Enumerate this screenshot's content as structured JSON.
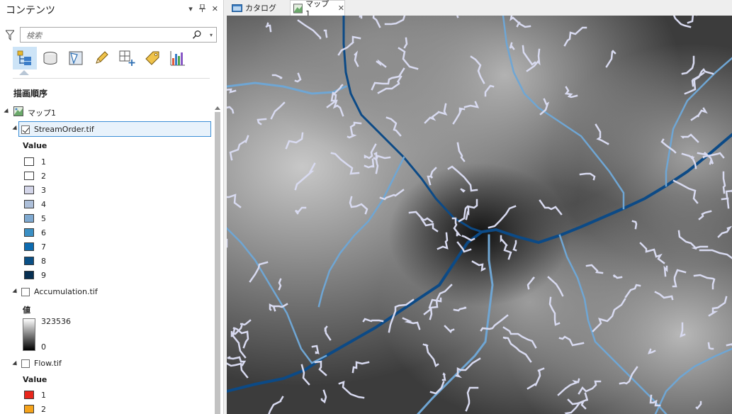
{
  "pane": {
    "title": "コンテンツ",
    "header_buttons": [
      "▾",
      "ᵖ",
      "✕"
    ],
    "search_placeholder": "検索",
    "toolbar_icons": [
      "list-by-drawing-order-icon",
      "list-by-data-source-icon",
      "list-by-selection-icon",
      "list-by-editing-icon",
      "list-by-snapping-icon",
      "list-by-labeling-icon",
      "list-by-charts-icon"
    ],
    "draw_order_label": "描画順序",
    "map_name": "マップ1",
    "layers": [
      {
        "name": "StreamOrder.tif",
        "checked": true,
        "legend_title": "Value",
        "classes": [
          {
            "label": "1",
            "color": "#ffffff"
          },
          {
            "label": "2",
            "color": "#ffffff"
          },
          {
            "label": "3",
            "color": "#d3d5e8"
          },
          {
            "label": "4",
            "color": "#adbfd9"
          },
          {
            "label": "5",
            "color": "#7fa9d0"
          },
          {
            "label": "6",
            "color": "#3a8fc4"
          },
          {
            "label": "7",
            "color": "#0d6bb0"
          },
          {
            "label": "8",
            "color": "#0a4f85"
          },
          {
            "label": "9",
            "color": "#072f52"
          }
        ]
      },
      {
        "name": "Accumulation.tif",
        "checked": false,
        "legend_title": "値",
        "ramp_max": "323536",
        "ramp_min": "0"
      },
      {
        "name": "Flow.tif",
        "checked": false,
        "legend_title": "Value",
        "classes": [
          {
            "label": "1",
            "color": "#e8261c"
          },
          {
            "label": "2",
            "color": "#f5a31b"
          }
        ]
      }
    ]
  },
  "tabs": [
    {
      "label": "カタログ",
      "active": false
    },
    {
      "label": "マップ1",
      "active": true
    }
  ],
  "colors": {
    "selection_border": "#3d8fd6",
    "accent": "#cde4f7",
    "stream_light": "#d8daf0",
    "stream_mid": "#6fa6d4",
    "stream_dark": "#0c4a86"
  }
}
